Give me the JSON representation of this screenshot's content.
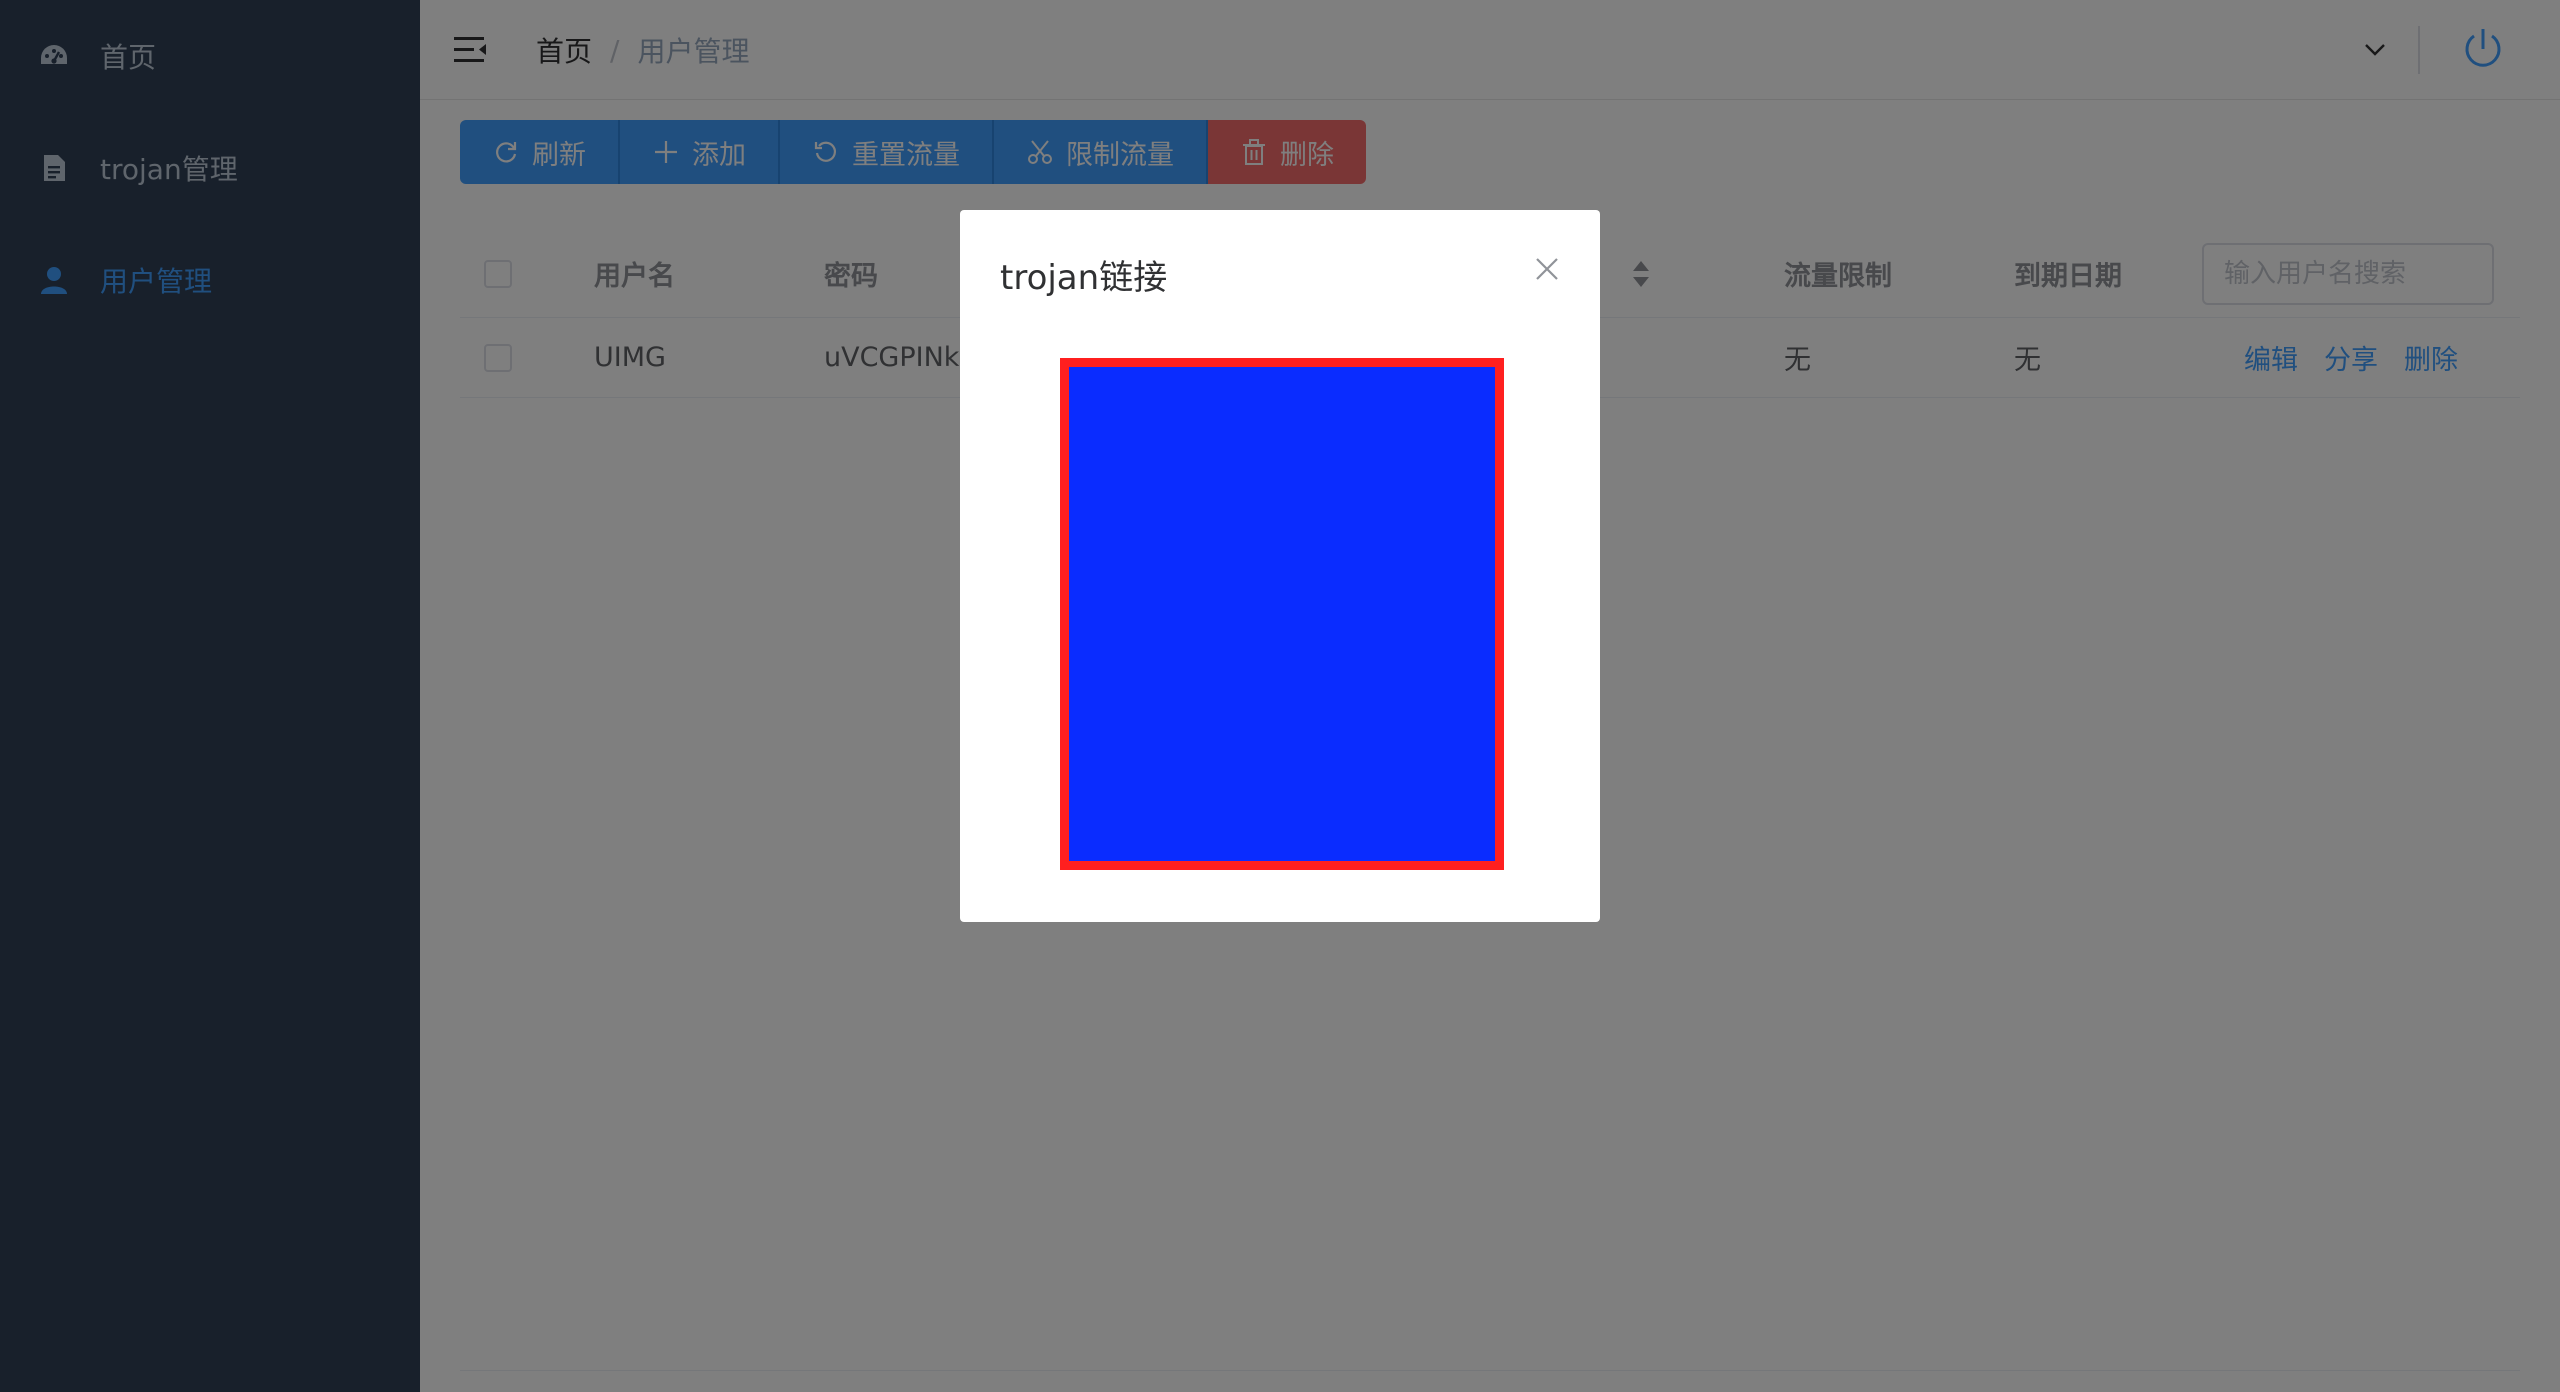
{
  "sidebar": {
    "items": [
      {
        "label": "首页",
        "icon": "dashboard-icon"
      },
      {
        "label": "trojan管理",
        "icon": "document-icon"
      },
      {
        "label": "用户管理",
        "icon": "user-icon",
        "active": true
      }
    ]
  },
  "navbar": {
    "breadcrumb": {
      "home": "首页",
      "separator": "/",
      "current": "用户管理"
    }
  },
  "toolbar": {
    "refresh": "刷新",
    "add": "添加",
    "reset_traffic": "重置流量",
    "limit_traffic": "限制流量",
    "delete": "删除"
  },
  "table": {
    "headers": {
      "username": "用户名",
      "password": "密码",
      "traffic_limit": "流量限制",
      "expiry_date": "到期日期"
    },
    "search_placeholder": "输入用户名搜索",
    "rows": [
      {
        "username": "UIMG",
        "password": "uVCGPINk",
        "traffic_limit": "无",
        "expiry_date": "无",
        "actions": {
          "edit": "编辑",
          "share": "分享",
          "delete": "删除"
        }
      }
    ]
  },
  "dialog": {
    "title": "trojan链接",
    "qr_color": "#0a2cff",
    "qr_border_color": "#ff1f1f"
  },
  "colors": {
    "sidebar_bg": "#304156",
    "primary": "#409eff",
    "danger": "#f56c6c"
  }
}
